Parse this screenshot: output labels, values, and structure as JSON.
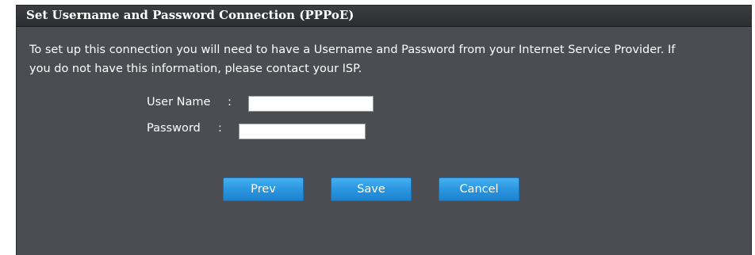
{
  "panel": {
    "title": "Set Username and Password Connection (PPPoE)",
    "description_line1": "To set up this connection you will need to have a Username and Password from your Internet Service Provider. If",
    "description_line2": "you do not have this information, please contact your ISP."
  },
  "form": {
    "username_label": "User Name",
    "username_colon": ":",
    "username_value": "",
    "password_label": "Password",
    "password_colon": ":",
    "password_value": ""
  },
  "buttons": {
    "prev_label": "Prev",
    "save_label": "Save",
    "cancel_label": "Cancel"
  },
  "colors": {
    "panel_background": "#4b4d52",
    "header_background": "#2c2e31",
    "button_blue": "#2a95e0",
    "text": "#ffffff"
  }
}
